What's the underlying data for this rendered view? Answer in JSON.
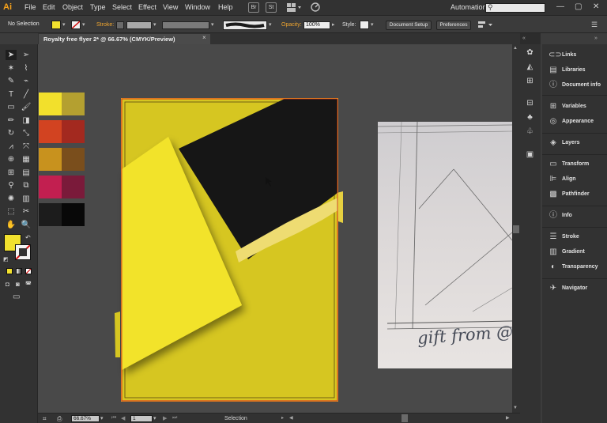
{
  "app": {
    "logo": "Ai"
  },
  "menu": [
    "File",
    "Edit",
    "Object",
    "Type",
    "Select",
    "Effect",
    "View",
    "Window",
    "Help"
  ],
  "menubar_icons": {
    "bridge": "Br",
    "stock": "St",
    "arrange": "arrange-docs-icon",
    "gpu": "gpu-icon"
  },
  "workspace": {
    "label": "Automation",
    "caret": "▾"
  },
  "search": {
    "placeholder": ""
  },
  "window_controls": {
    "minimize": "—",
    "maximize": "▢",
    "close": "✕"
  },
  "control": {
    "selection_label": "No Selection",
    "fill_color": "#f2e12e",
    "stroke_label": "Stroke:",
    "opacity_label": "Opacity:",
    "opacity_value": "100%",
    "style_label": "Style:",
    "document_setup": "Document Setup",
    "preferences": "Preferences"
  },
  "document": {
    "tab_title": "Royalty free flyer 2* @ 66.67% (CMYK/Preview)",
    "close": "×"
  },
  "tools": [
    "selection-tool",
    "direct-selection-tool",
    "magic-wand-tool",
    "lasso-tool",
    "pen-tool",
    "curvature-tool",
    "type-tool",
    "line-segment-tool",
    "rectangle-tool",
    "paintbrush-tool",
    "pencil-tool",
    "eraser-tool",
    "rotate-tool",
    "scale-tool",
    "width-tool",
    "free-transform-tool",
    "shape-builder-tool",
    "perspective-grid-tool",
    "mesh-tool",
    "gradient-tool",
    "eyedropper-tool",
    "blend-tool",
    "symbol-sprayer-tool",
    "column-graph-tool",
    "artboard-tool",
    "slice-tool",
    "hand-tool",
    "zoom-tool"
  ],
  "tool_fill_color": "#f2e12e",
  "swatches": [
    "#f2e02c",
    "#b4a030",
    "#d24321",
    "#a3291f",
    "#c8921e",
    "#7a4e1c",
    "#c21f50",
    "#7a1a3a",
    "#1c1c1c",
    "#080808"
  ],
  "artwork_colors": {
    "background": "#d6c621",
    "dark": "#161616",
    "yellow": "#f2e32b",
    "frame": "#e8a81f"
  },
  "panels": [
    "Links",
    "Libraries",
    "Document info",
    "Variables",
    "Appearance",
    "Layers",
    "Transform",
    "Align",
    "Pathfinder",
    "Info",
    "Stroke",
    "Gradient",
    "Transparency",
    "Navigator"
  ],
  "photo_text": "gift from @ p",
  "status": {
    "zoom": "66.67%",
    "artboard": "1",
    "tool": "Selection"
  }
}
